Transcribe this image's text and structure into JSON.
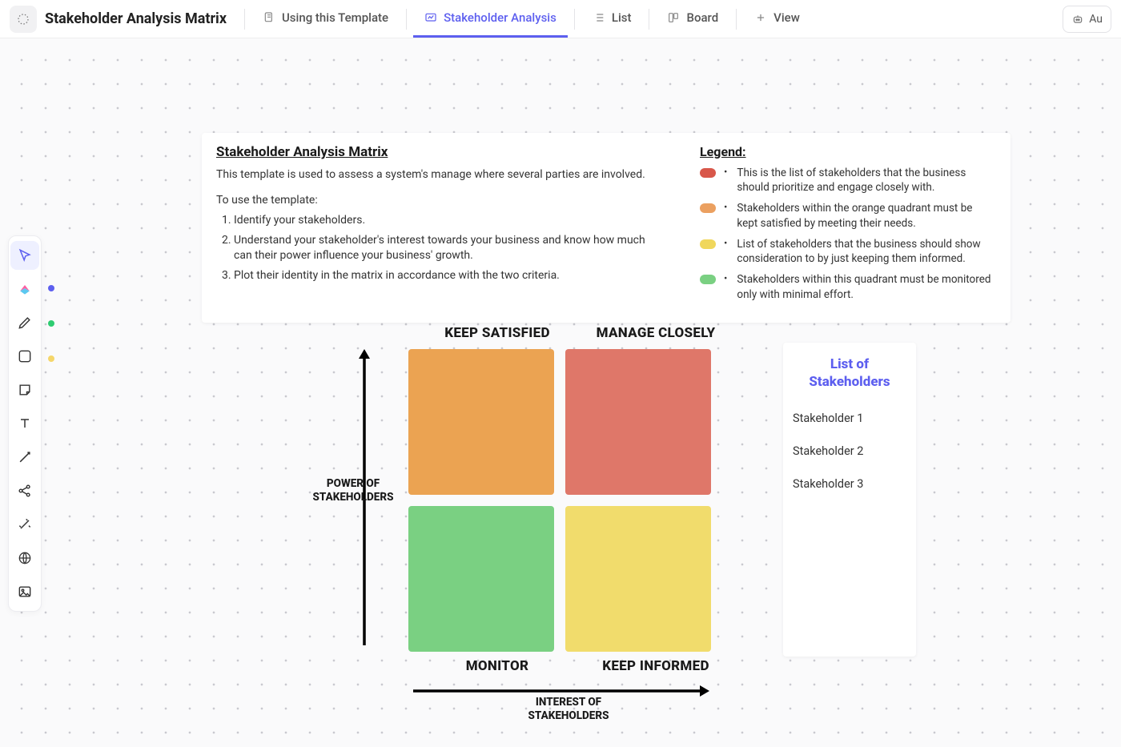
{
  "header": {
    "title": "Stakeholder Analysis Matrix",
    "tabs": [
      {
        "label": "Using this Template",
        "icon": "template-icon"
      },
      {
        "label": "Stakeholder Analysis",
        "icon": "whiteboard-icon"
      },
      {
        "label": "List",
        "icon": "list-icon"
      },
      {
        "label": "Board",
        "icon": "board-icon"
      }
    ],
    "addView": "View",
    "activeTabIndex": 1,
    "rightButton": "Au"
  },
  "description": {
    "title": "Stakeholder Analysis Matrix",
    "subtitle": "This template is used to assess a system's manage where several parties are involved.",
    "howto": "To use the template:",
    "steps": [
      "Identify your stakeholders.",
      "Understand your stakeholder's interest towards your business and know how much can their power influence your business' growth.",
      "Plot their identity in the matrix in accordance with the two criteria."
    ]
  },
  "legend": {
    "title": "Legend:",
    "items": [
      {
        "color": "#d8574a",
        "text": "This is the list of stakeholders that the business should prioritize and engage closely with."
      },
      {
        "color": "#eba060",
        "text": "Stakeholders within the orange quadrant must be kept satisfied by meeting their needs."
      },
      {
        "color": "#f0d75c",
        "text": "List of stakeholders that the business should show consideration to by just keeping them informed."
      },
      {
        "color": "#7ad082",
        "text": "Stakeholders within this quadrant must be monitored only with minimal effort."
      }
    ]
  },
  "matrix": {
    "yAxisLabel": "POWER OF STAKEHOLDERS",
    "xAxisLabel": "INTEREST OF STAKEHOLDERS",
    "quadrants": {
      "topLeft": "KEEP SATISFIED",
      "topRight": "MANAGE CLOSELY",
      "bottomLeft": "MONITOR",
      "bottomRight": "KEEP INFORMED"
    }
  },
  "stakeholders": {
    "title": "List of Stakeholders",
    "items": [
      "Stakeholder 1",
      "Stakeholder 2",
      "Stakeholder 3"
    ]
  },
  "toolbar": {
    "tools": [
      "pointer",
      "clickup-ai",
      "pen",
      "shape",
      "sticky",
      "text",
      "connector",
      "mindmap",
      "sparkle",
      "web",
      "image"
    ],
    "colorDots": [
      "#5d5fef",
      "#2ecc71",
      "#f5d66a"
    ]
  }
}
